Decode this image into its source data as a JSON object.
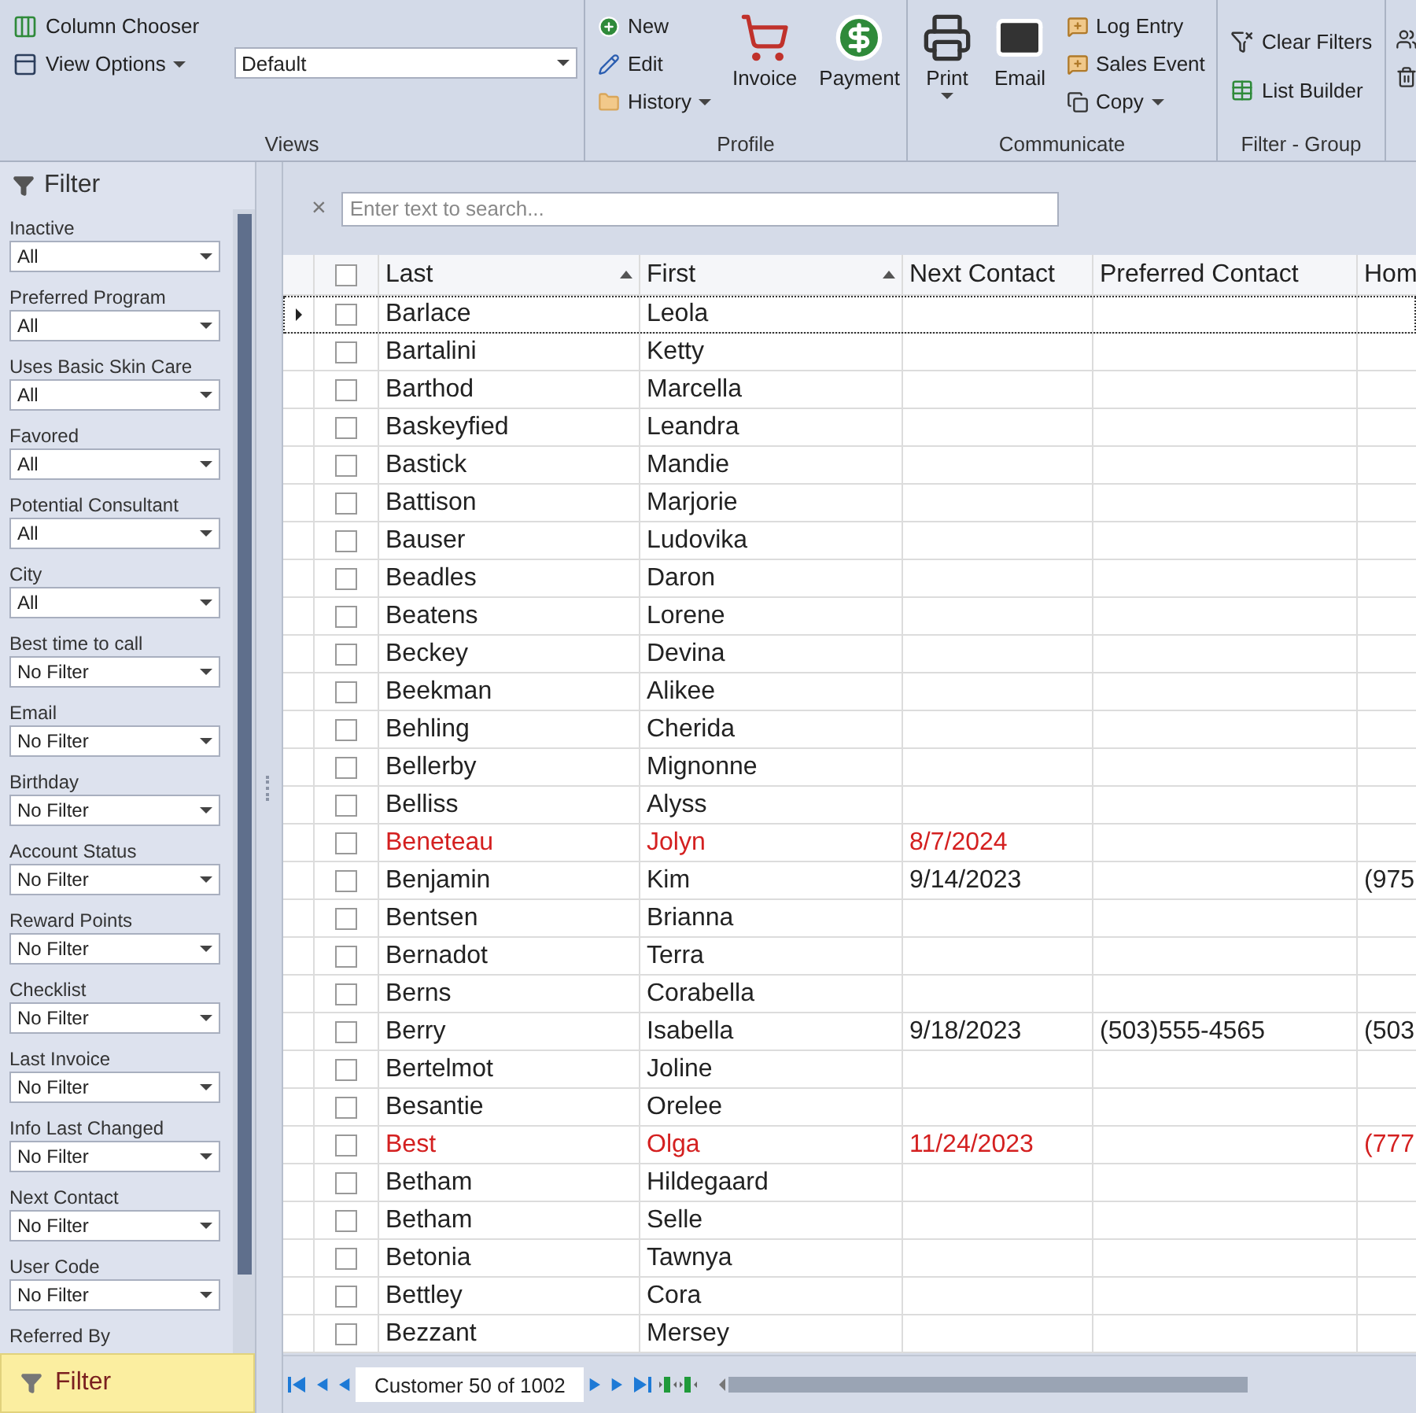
{
  "ribbon": {
    "groups": [
      {
        "kind": "views",
        "title": "Views",
        "column_chooser": "Column Chooser",
        "view_options": "View Options",
        "view_select": "Default"
      },
      {
        "kind": "profile",
        "title": "Profile",
        "small": [
          "New",
          "Edit",
          "History"
        ],
        "large": [
          "Invoice",
          "Payment"
        ]
      },
      {
        "kind": "communicate",
        "title": "Communicate",
        "large": [
          "Print",
          "Email"
        ],
        "small": [
          "Log Entry",
          "Sales Event",
          "Copy"
        ]
      },
      {
        "kind": "filter",
        "title": "Filter - Group",
        "small": [
          "Clear Filters",
          "List Builder"
        ]
      },
      {
        "kind": "cut"
      }
    ]
  },
  "filter_panel": {
    "title": "Filter",
    "filters": [
      {
        "label": "Inactive",
        "value": "All"
      },
      {
        "label": "Preferred Program",
        "value": "All"
      },
      {
        "label": "Uses Basic Skin Care",
        "value": "All"
      },
      {
        "label": "Favored",
        "value": "All"
      },
      {
        "label": "Potential Consultant",
        "value": "All"
      },
      {
        "label": "City",
        "value": "All"
      },
      {
        "label": "Best time to call",
        "value": "No Filter"
      },
      {
        "label": "Email",
        "value": "No Filter"
      },
      {
        "label": "Birthday",
        "value": "No Filter"
      },
      {
        "label": "Account Status",
        "value": "No Filter"
      },
      {
        "label": "Reward Points",
        "value": "No Filter"
      },
      {
        "label": "Checklist",
        "value": "No Filter"
      },
      {
        "label": "Last Invoice",
        "value": "No Filter"
      },
      {
        "label": "Info Last Changed",
        "value": "No Filter"
      },
      {
        "label": "Next Contact",
        "value": "No Filter"
      },
      {
        "label": "User Code",
        "value": "No Filter"
      },
      {
        "label": "Referred By"
      }
    ],
    "button": "Filter"
  },
  "search": {
    "clear": "×",
    "placeholder": "Enter text to search..."
  },
  "table": {
    "all_checked": false,
    "columns": [
      {
        "label": "Last",
        "sorted": true
      },
      {
        "label": "First",
        "sorted": true
      },
      {
        "label": "Next Contact",
        "sorted": false
      },
      {
        "label": "Preferred Contact",
        "sorted": false
      },
      {
        "label": "Hom",
        "sorted": false
      }
    ],
    "rows": [
      {
        "cells": [
          "Barlace",
          "Leola",
          "",
          "",
          ""
        ],
        "overdue": false,
        "checked": false,
        "selected": true
      },
      {
        "cells": [
          "Bartalini",
          "Ketty",
          "",
          "",
          ""
        ],
        "overdue": false,
        "checked": false,
        "selected": false
      },
      {
        "cells": [
          "Barthod",
          "Marcella",
          "",
          "",
          ""
        ],
        "overdue": false,
        "checked": false,
        "selected": false
      },
      {
        "cells": [
          "Baskeyfied",
          "Leandra",
          "",
          "",
          ""
        ],
        "overdue": false,
        "checked": false,
        "selected": false
      },
      {
        "cells": [
          "Bastick",
          "Mandie",
          "",
          "",
          ""
        ],
        "overdue": false,
        "checked": false,
        "selected": false
      },
      {
        "cells": [
          "Battison",
          "Marjorie",
          "",
          "",
          ""
        ],
        "overdue": false,
        "checked": false,
        "selected": false
      },
      {
        "cells": [
          "Bauser",
          "Ludovika",
          "",
          "",
          ""
        ],
        "overdue": false,
        "checked": false,
        "selected": false
      },
      {
        "cells": [
          "Beadles",
          "Daron",
          "",
          "",
          ""
        ],
        "overdue": false,
        "checked": false,
        "selected": false
      },
      {
        "cells": [
          "Beatens",
          "Lorene",
          "",
          "",
          ""
        ],
        "overdue": false,
        "checked": false,
        "selected": false
      },
      {
        "cells": [
          "Beckey",
          "Devina",
          "",
          "",
          ""
        ],
        "overdue": false,
        "checked": false,
        "selected": false
      },
      {
        "cells": [
          "Beekman",
          "Alikee",
          "",
          "",
          ""
        ],
        "overdue": false,
        "checked": false,
        "selected": false
      },
      {
        "cells": [
          "Behling",
          "Cherida",
          "",
          "",
          ""
        ],
        "overdue": false,
        "checked": false,
        "selected": false
      },
      {
        "cells": [
          "Bellerby",
          "Mignonne",
          "",
          "",
          ""
        ],
        "overdue": false,
        "checked": false,
        "selected": false
      },
      {
        "cells": [
          "Belliss",
          "Alyss",
          "",
          "",
          ""
        ],
        "overdue": false,
        "checked": false,
        "selected": false
      },
      {
        "cells": [
          "Beneteau",
          "Jolyn",
          "8/7/2024",
          "",
          ""
        ],
        "overdue": true,
        "checked": false,
        "selected": false
      },
      {
        "cells": [
          "Benjamin",
          "Kim",
          "9/14/2023",
          "",
          "(975"
        ],
        "overdue": false,
        "checked": false,
        "selected": false
      },
      {
        "cells": [
          "Bentsen",
          "Brianna",
          "",
          "",
          ""
        ],
        "overdue": false,
        "checked": false,
        "selected": false
      },
      {
        "cells": [
          "Bernadot",
          "Terra",
          "",
          "",
          ""
        ],
        "overdue": false,
        "checked": false,
        "selected": false
      },
      {
        "cells": [
          "Berns",
          "Corabella",
          "",
          "",
          ""
        ],
        "overdue": false,
        "checked": false,
        "selected": false
      },
      {
        "cells": [
          "Berry",
          "Isabella",
          "9/18/2023",
          "(503)555-4565",
          "(503"
        ],
        "overdue": false,
        "checked": false,
        "selected": false
      },
      {
        "cells": [
          "Bertelmot",
          "Joline",
          "",
          "",
          ""
        ],
        "overdue": false,
        "checked": false,
        "selected": false
      },
      {
        "cells": [
          "Besantie",
          "Orelee",
          "",
          "",
          ""
        ],
        "overdue": false,
        "checked": false,
        "selected": false
      },
      {
        "cells": [
          "Best",
          "Olga",
          "11/24/2023",
          "",
          "(777"
        ],
        "overdue": true,
        "checked": false,
        "selected": false
      },
      {
        "cells": [
          "Betham",
          "Hildegaard",
          "",
          "",
          ""
        ],
        "overdue": false,
        "checked": false,
        "selected": false
      },
      {
        "cells": [
          "Betham",
          "Selle",
          "",
          "",
          ""
        ],
        "overdue": false,
        "checked": false,
        "selected": false
      },
      {
        "cells": [
          "Betonia",
          "Tawnya",
          "",
          "",
          ""
        ],
        "overdue": false,
        "checked": false,
        "selected": false
      },
      {
        "cells": [
          "Bettley",
          "Cora",
          "",
          "",
          ""
        ],
        "overdue": false,
        "checked": false,
        "selected": false
      },
      {
        "cells": [
          "Bezzant",
          "Mersey",
          "",
          "",
          ""
        ],
        "overdue": false,
        "checked": false,
        "selected": false
      }
    ]
  },
  "navigator": {
    "record": "Customer 50 of 1002"
  }
}
